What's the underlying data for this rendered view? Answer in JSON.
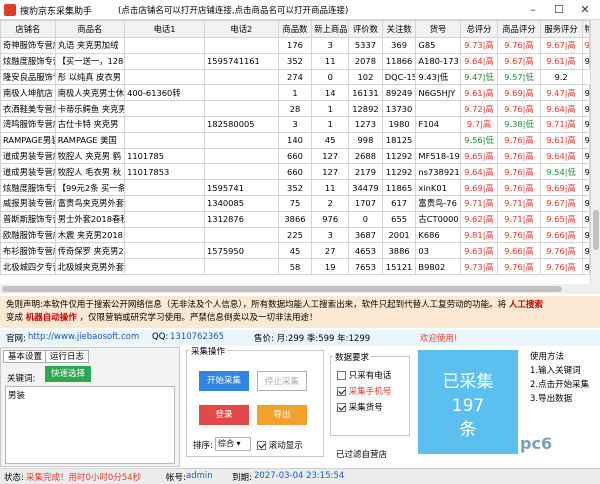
{
  "window": {
    "title": "搜豹京东采集助手",
    "hint": "(点击店铺名可以打开店铺连接,点击商品名可以打开商品连接)",
    "min_glyph": "–",
    "max_glyph": "☐",
    "close_glyph": "✕"
  },
  "table": {
    "columns": [
      "店铺名",
      "商品名",
      "电话1",
      "电话2",
      "商品数",
      "新上商品",
      "评价数",
      "关注数",
      "货号",
      "总评分",
      "商品评分",
      "服务评分",
      "物流评"
    ],
    "rows": [
      [
        "奇神服饰专营店",
        "丸语 夹克男加绒",
        "",
        "",
        "176",
        "3",
        "5337",
        "369",
        "G85",
        "9.73|高",
        "9.76|高",
        "9.67|高",
        "9.75|高"
      ],
      [
        "炫融度服饰专营店",
        "【买一送一，128",
        "",
        "1595741161",
        "352",
        "11",
        "2078",
        "11866",
        "A180-173",
        "9.64|高",
        "9.67|高",
        "9.61|高",
        "9.6"
      ],
      [
        "隆安良品服饰专营",
        "彤 以纯真 皮衣男",
        "",
        "",
        "274",
        "0",
        "102",
        "DQC-156",
        "9.43|低",
        "9.47|低",
        "9.57|低",
        "9.2"
      ],
      [
        "南极人坤航店",
        "南极人夹克男士休",
        "400-61360转",
        "",
        "1",
        "14",
        "16131",
        "89249",
        "N6G5HJY",
        "9.61|高",
        "9.69|高",
        "9.47|高",
        "9.6"
      ],
      [
        "衣洒鞋美专营店",
        "卡蒂乐鳄鱼 夹克男",
        "",
        "",
        "28",
        "1",
        "12892",
        "13730",
        "",
        "9.72|高",
        "9.76|高",
        "9.64|高",
        "9.6"
      ],
      [
        "湾鸣服饰专营店",
        "古仕卡特 夹克男",
        "",
        "182580005",
        "3",
        "1",
        "1273",
        "1980",
        "F104",
        "9.7|高",
        "9.38|低",
        "9.71|高",
        "9.8"
      ],
      [
        "RAMPAGE男装旗",
        "RAMPAGE 美国",
        "",
        "",
        "140",
        "45",
        "998",
        "18125",
        "",
        "9.56|低",
        "9.76|高",
        "9.61|高",
        "9.2"
      ],
      [
        "道成男装专营店",
        "牧腔人 夹克男 鹤",
        "1101785",
        "",
        "660",
        "127",
        "2688",
        "11292",
        "MF518-19",
        "9.65|高",
        "9.76|高",
        "9.64|高",
        "9.4"
      ],
      [
        "道成男装专营店",
        "牧腔人 毛衣男 秋",
        "11017853",
        "",
        "660",
        "127",
        "2179",
        "11292",
        "ns738921",
        "9.64|高",
        "9.76|高",
        "9.54|低",
        "9.6"
      ],
      [
        "炫融度服饰专营店",
        "【99元2条 买一条",
        "",
        "1595741",
        "352",
        "11",
        "34479",
        "11865",
        "xinK01",
        "9.69|高",
        "9.76|高",
        "9.69|高",
        "9.6"
      ],
      [
        "威报男装专营店",
        "富贵鸟夹克男外套",
        "",
        "1340085",
        "75",
        "2",
        "1707",
        "617",
        "富贵鸟-76",
        "9.71|高",
        "9.71|高",
        "9.67|高",
        "9.6"
      ],
      [
        "普斯斯服饰专营店",
        "男士外套2018春秋",
        "",
        "1312876",
        "3866",
        "976",
        "0",
        "655",
        "古CT0000",
        "9.62|高",
        "9.71|高",
        "9.65|高",
        "9.5"
      ],
      [
        "欧融服饰专营店",
        "木震 夹克男2018",
        "",
        "",
        "225",
        "3",
        "3687",
        "2001",
        "K686",
        "9.81|高",
        "9.76|高",
        "9.66|高",
        "9.7"
      ],
      [
        "布衫服饰专营店",
        "传奇保罗 夹克男2",
        "",
        "1575950",
        "45",
        "27",
        "4653",
        "3886",
        "03",
        "9.63|高",
        "9.66|高",
        "9.76|高",
        "9.4"
      ],
      [
        "北极城四夕专营店",
        "北极城夹克男外套",
        "",
        "",
        "58",
        "19",
        "7653",
        "15121",
        "B9802",
        "9.73|高",
        "9.76|高",
        "9.76|高",
        "9.7"
      ]
    ]
  },
  "disclaimer": {
    "line1": "免则声明:本软件仅用于搜索公开网络信息（无非法及个人信息），所有数据均能人工搜索出来，软件只起到代替人工复劳动的功能。将",
    "line1_bold": "人工搜索",
    "line2_pre": "变成",
    "line2_bold": "机器自动操作",
    "line2_post": "，仅限营销或研究学习使用。严禁信息倒卖以及一切非法用途！"
  },
  "infobar": {
    "site_label": "官网:",
    "site_url": "http://www.jiebaosoft.com",
    "qq_label": "QQ:",
    "qq_value": "1310762365",
    "price": "售价: 月:299 季:599 年:1299",
    "welcome": "欢迎使用!"
  },
  "left_panel": {
    "tab1": "基本设置",
    "tab2": "运行日志",
    "keyword_label": "关键词:",
    "select_button": "快速选择",
    "keyword_value": "男装"
  },
  "ops": {
    "title": "采集操作",
    "start": "开始采集",
    "stop": "停止采集",
    "login": "登录",
    "export": "导出",
    "sort_label": "排序:",
    "sort_value": "综合 ▾",
    "autoscroll": "滚动显示"
  },
  "req": {
    "title": "数据要求",
    "only_phone": "只采有电话",
    "phone": "采集手机号",
    "sku": "采集货号",
    "filter": "已过滤自营店"
  },
  "bigbox": {
    "line1": "已采集",
    "line2": "197",
    "line3": "条"
  },
  "usage": {
    "title": "使用方法",
    "step1": "1.输入关键词",
    "step2": "2.点击开始采集",
    "step3": "3.导出数据"
  },
  "status": {
    "label": "状态:",
    "value": "采集完成！用时0小时0分54秒",
    "account_label": "帐号:",
    "account": "admin",
    "expire_label": "到期:",
    "expire": "2027-03-04 23:15:54"
  },
  "watermark": "pc6"
}
